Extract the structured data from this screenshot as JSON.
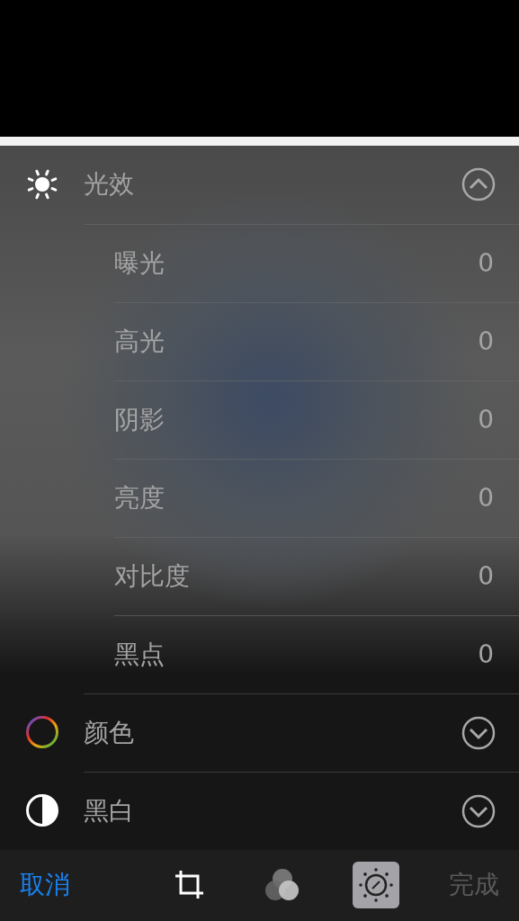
{
  "sections": [
    {
      "kind": "light",
      "label": "光效",
      "expanded": true,
      "items": [
        {
          "label": "曝光",
          "value": "0"
        },
        {
          "label": "高光",
          "value": "0"
        },
        {
          "label": "阴影",
          "value": "0"
        },
        {
          "label": "亮度",
          "value": "0"
        },
        {
          "label": "对比度",
          "value": "0"
        },
        {
          "label": "黑点",
          "value": "0"
        }
      ]
    },
    {
      "kind": "color",
      "label": "颜色",
      "expanded": false
    },
    {
      "kind": "bw",
      "label": "黑白",
      "expanded": false
    }
  ],
  "toolbar": {
    "cancel": "取消",
    "tools": [
      {
        "kind": "crop",
        "selected": false
      },
      {
        "kind": "filters",
        "selected": false
      },
      {
        "kind": "adjust",
        "selected": true
      }
    ],
    "done": {
      "label": "完成",
      "disabled": true
    }
  }
}
